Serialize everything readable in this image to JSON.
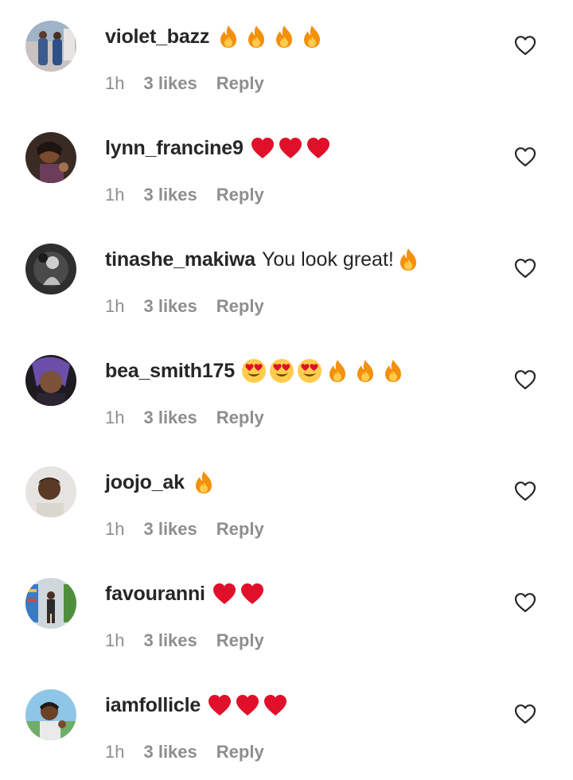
{
  "comments": [
    {
      "username": "violet_bazz",
      "text": "",
      "emojis": [
        "fire",
        "fire",
        "fire",
        "fire"
      ],
      "time": "1h",
      "likes": "3 likes",
      "reply": "Reply",
      "avatar": "photo-two-people"
    },
    {
      "username": "lynn_francine9",
      "text": "",
      "emojis": [
        "red-heart",
        "red-heart",
        "red-heart"
      ],
      "time": "1h",
      "likes": "3 likes",
      "reply": "Reply",
      "avatar": "photo-woman"
    },
    {
      "username": "tinashe_makiwa",
      "text": "You look great!",
      "emojis": [
        "fire"
      ],
      "time": "1h",
      "likes": "3 likes",
      "reply": "Reply",
      "avatar": "photo-grayscale"
    },
    {
      "username": "bea_smith175",
      "text": "",
      "emojis": [
        "heart-eyes",
        "heart-eyes",
        "heart-eyes",
        "fire",
        "fire",
        "fire"
      ],
      "time": "1h",
      "likes": "3 likes",
      "reply": "Reply",
      "avatar": "photo-girl"
    },
    {
      "username": "joojo_ak",
      "text": "",
      "emojis": [
        "fire"
      ],
      "time": "1h",
      "likes": "3 likes",
      "reply": "Reply",
      "avatar": "photo-man"
    },
    {
      "username": "favouranni",
      "text": "",
      "emojis": [
        "red-heart",
        "red-heart"
      ],
      "time": "1h",
      "likes": "3 likes",
      "reply": "Reply",
      "avatar": "photo-store"
    },
    {
      "username": "iamfollicle",
      "text": "",
      "emojis": [
        "red-heart",
        "red-heart",
        "red-heart"
      ],
      "time": "1h",
      "likes": "3 likes",
      "reply": "Reply",
      "avatar": "photo-woman-outdoor"
    }
  ],
  "colors": {
    "username": "#262626",
    "meta": "#8e8e8e",
    "heart_emoji": "#e0102a",
    "fire_outer": "#f4900c",
    "fire_inner": "#ffcc4d",
    "heart_eyes_face": "#ffcc4d",
    "like_icon_stroke": "#262626"
  }
}
